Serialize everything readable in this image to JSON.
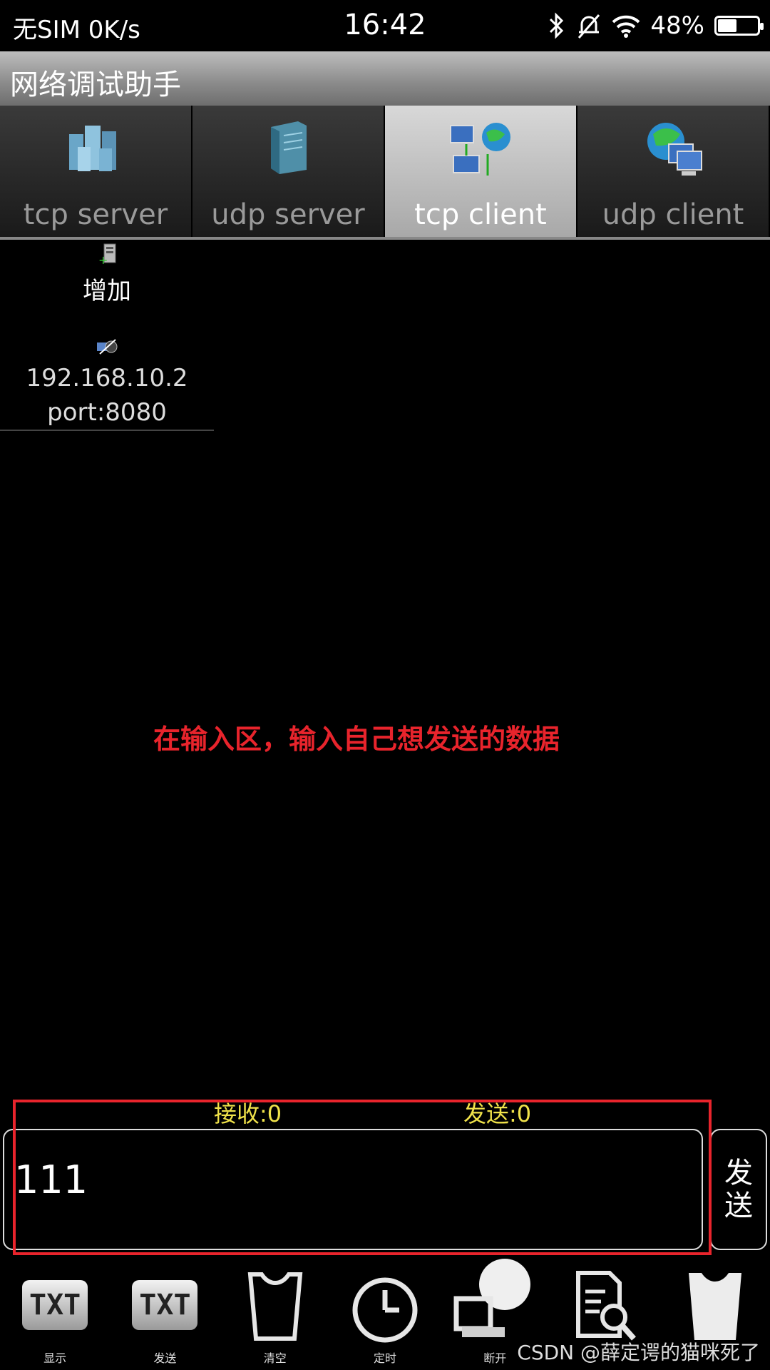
{
  "status_bar": {
    "carrier": "无SIM",
    "speed": "0K/s",
    "time": "16:42",
    "battery": "48%",
    "battery_level": 0.48,
    "icons": [
      "bluetooth-icon",
      "mute-bell-icon",
      "wifi-icon",
      "battery-icon"
    ]
  },
  "app": {
    "title": "网络调试助手"
  },
  "tabs": [
    {
      "label": "tcp server",
      "icon": "server-cluster-icon",
      "active": false
    },
    {
      "label": "udp server",
      "icon": "server-tower-icon",
      "active": false
    },
    {
      "label": "tcp client",
      "icon": "network-client-icon",
      "active": true
    },
    {
      "label": "udp client",
      "icon": "globe-computer-icon",
      "active": false
    }
  ],
  "connections": {
    "add_label": "增加",
    "items": [
      {
        "ip": "192.168.10.2",
        "port": "port:8080"
      }
    ]
  },
  "annotation": "在输入区，输入自己想发送的数据",
  "counters": {
    "receive": "接收:0",
    "send": "发送:0"
  },
  "input": {
    "value": "111"
  },
  "send_button": {
    "label": "发送"
  },
  "toolbar": [
    {
      "label": "显示",
      "icon": "txt-display-icon"
    },
    {
      "label": "发送",
      "icon": "txt-send-icon"
    },
    {
      "label": "清空",
      "icon": "clear-cup-icon"
    },
    {
      "label": "定时",
      "icon": "clock-icon"
    },
    {
      "label": "断开",
      "icon": "disconnect-icon"
    },
    {
      "label": "",
      "icon": "doc-search-icon"
    },
    {
      "label": "",
      "icon": "cup-icon"
    }
  ],
  "watermark": "CSDN @薛定谔的猫咪死了",
  "colors": {
    "annotation_red": "#e8242c",
    "counter_yellow": "#f0e24a"
  }
}
